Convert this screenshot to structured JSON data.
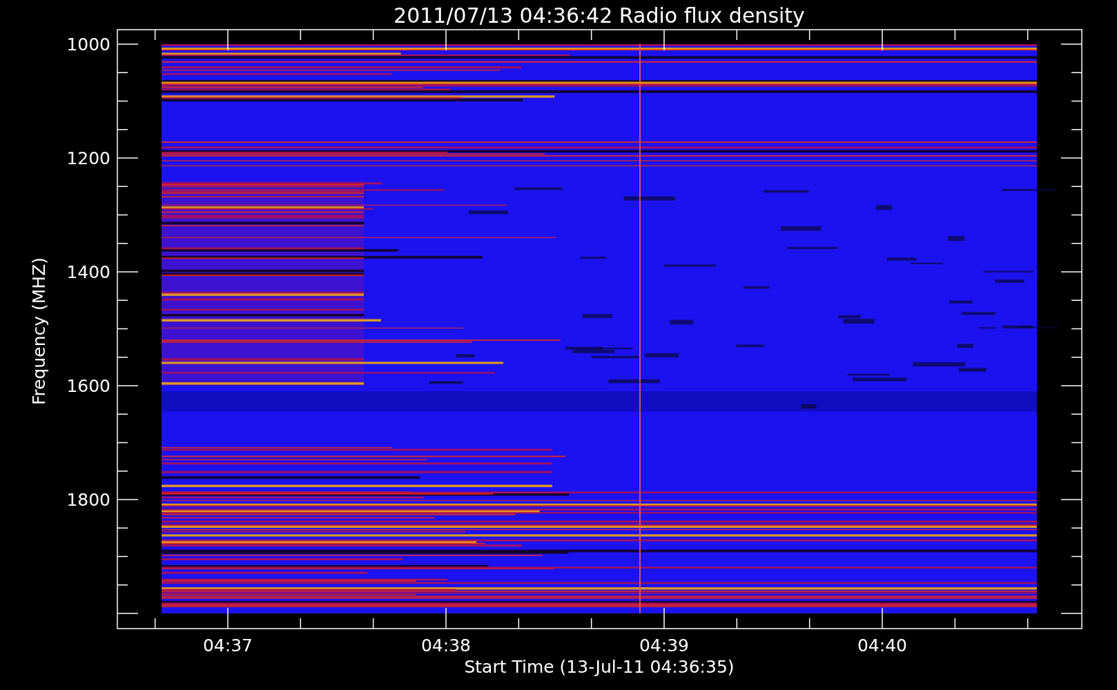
{
  "chart": {
    "title": "2011/07/13 04:36:42 Radio flux density",
    "ylabel": "Frequency (MHZ)",
    "xlabel": "Start Time (13-Jul-11 04:36:35)",
    "yticks": [
      "1000",
      "1200",
      "1400",
      "1600",
      "1800"
    ],
    "xticks": [
      "04:37",
      "04:38",
      "04:39",
      "04:40"
    ]
  }
}
